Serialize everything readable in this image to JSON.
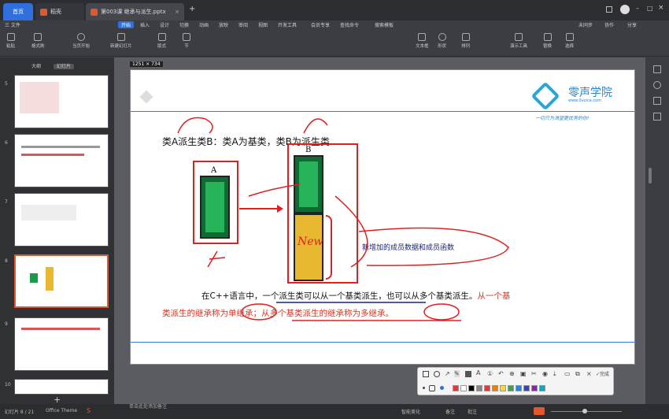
{
  "titlebar": {
    "tabs": [
      {
        "label": "首页"
      },
      {
        "label": "稻壳"
      },
      {
        "label": "第003课 继承与派生.pptx"
      }
    ],
    "add_tab": "+"
  },
  "menubar": {
    "items": [
      "三 文件",
      "开始",
      "插入",
      "设计",
      "切换",
      "动画",
      "放映",
      "审阅",
      "视图",
      "开发工具",
      "会员专享",
      "查找命令",
      "搜索模板"
    ],
    "active": "开始",
    "right": [
      "未同步",
      "协作",
      "分享"
    ]
  },
  "toolbar": {
    "groups": [
      "粘贴",
      "格式刷",
      "当页开始",
      "新建幻灯片",
      "版式",
      "节",
      "文本框",
      "形状",
      "排列",
      "演示工具",
      "替换",
      "选择"
    ]
  },
  "leftpanel": {
    "tabs": [
      "大纲",
      "幻灯片"
    ],
    "slide_numbers": [
      "5",
      "6",
      "7",
      "8",
      "9",
      "10"
    ],
    "add": "+"
  },
  "canvas": {
    "size_chip": "1251 × 734"
  },
  "slide": {
    "logo_text": "零声学院",
    "logo_url": "www.0voice.com",
    "logo_slogan": "一切只为渴望更优秀的你!",
    "heading": "类A派生类B：类A为基类，类B为派生类",
    "box_a_label": "A",
    "box_b_label": "B",
    "new_members": "新增加的成员数据和成员函数",
    "paragraph_black": "在C++语言中，一个派生类可以从一个基类派生，也可以从多个基类派生。",
    "paragraph_red1": "从一个基",
    "paragraph_red2": "类派生的继承称为单继承；从多个基类派生的继承称为多继承。",
    "annotation_new": "New"
  },
  "drawbar": {
    "done": "完成",
    "colors": [
      "#e53935",
      "#ffffff",
      "#000000",
      "#888888",
      "#e53935",
      "#f57c00",
      "#fdd835",
      "#43a047",
      "#1e88e5",
      "#3949ab",
      "#8e24aa",
      "#00acc1"
    ]
  },
  "statusbar": {
    "slide_info": "幻灯片 8 / 21",
    "theme": "Office Theme",
    "notes": "单击此处添加备注",
    "smart": "智能美化",
    "notes_btn": "备注",
    "comment": "批注"
  }
}
